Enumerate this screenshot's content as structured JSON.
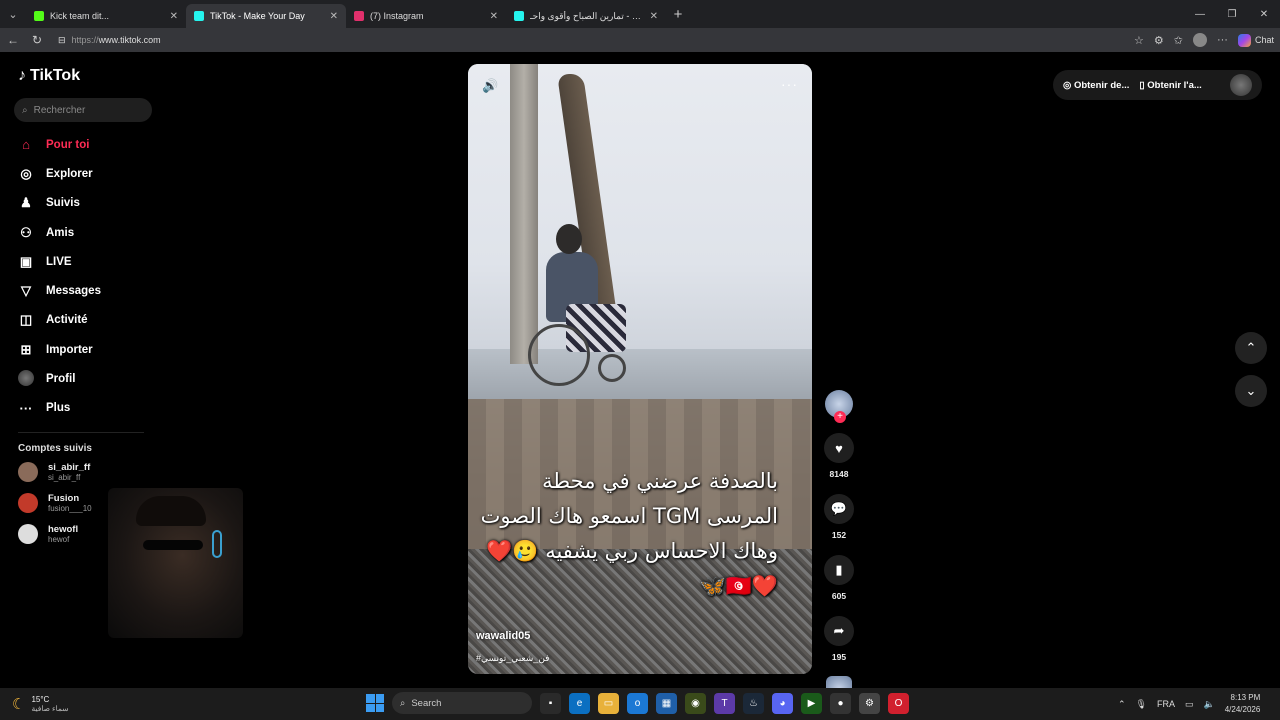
{
  "browser": {
    "tabs": [
      {
        "title": "Kick team dit...",
        "favicon_color": "#53fc18",
        "active": false
      },
      {
        "title": "TikTok - Make Your Day",
        "favicon_color": "#25f4ee",
        "active": true
      },
      {
        "title": "(7) Instagram",
        "favicon_color": "#e1306c",
        "active": false
      },
      {
        "title": "باشا البلد - تمارين الصباح وأقوى واحـ",
        "favicon_color": "#25f4ee",
        "active": false
      }
    ],
    "url_scheme": "https://",
    "url_host": "www.tiktok.com",
    "chat_label": "Chat"
  },
  "tiktok": {
    "logo_text": "TikTok",
    "search_placeholder": "Rechercher",
    "nav": [
      {
        "label": "Pour toi",
        "icon": "home-icon",
        "glyph": "⌂"
      },
      {
        "label": "Explorer",
        "icon": "compass-icon",
        "glyph": "◎"
      },
      {
        "label": "Suivis",
        "icon": "user-follow-icon",
        "glyph": "♟"
      },
      {
        "label": "Amis",
        "icon": "friends-icon",
        "glyph": "⚇"
      },
      {
        "label": "LIVE",
        "icon": "live-icon",
        "glyph": "▣"
      },
      {
        "label": "Messages",
        "icon": "send-icon",
        "glyph": "▽"
      },
      {
        "label": "Activité",
        "icon": "activity-icon",
        "glyph": "◫"
      },
      {
        "label": "Importer",
        "icon": "upload-icon",
        "glyph": "⊞"
      },
      {
        "label": "Profil",
        "icon": "profile-avatar",
        "glyph": ""
      },
      {
        "label": "Plus",
        "icon": "more-icon",
        "glyph": "···"
      }
    ],
    "following_title": "Comptes suivis",
    "following": [
      {
        "name": "si_abir_ff",
        "handle": "si_abir_ff",
        "avatar_color": "#8a6b5a"
      },
      {
        "name": "Fusion",
        "handle": "fusion___10",
        "avatar_color": "#c23a2a"
      },
      {
        "name": "hewofl",
        "handle": "hewof",
        "avatar_color": "#dddddd"
      }
    ],
    "top_buttons": {
      "get_coins": "Obtenir de...",
      "get_app": "Obtenir l'a..."
    },
    "video": {
      "caption": "بالصدفة عرضني في محطة المرسى TGM اسمعو هاك الصوت وهاك الاحساس ربي يشفيه 🥲❤️❤️🇹🇳🦋",
      "username": "wawalid05",
      "hashtag": "#فن_شعبي_تونسي"
    },
    "stats": {
      "likes": "8148",
      "comments": "152",
      "saves": "605",
      "shares": "195"
    }
  },
  "taskbar": {
    "temperature": "15°C",
    "weather_desc": "سماء صافية",
    "search_label": "Search",
    "language": "FRA",
    "time": "8:13 PM",
    "date": "4/24/2026"
  }
}
